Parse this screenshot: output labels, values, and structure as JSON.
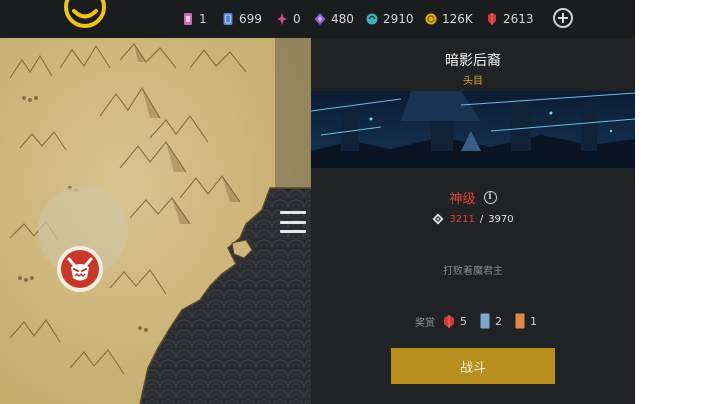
{
  "resources": [
    {
      "icon": "ticket-icon",
      "value": "1",
      "color": "#c86bb8"
    },
    {
      "icon": "card-icon",
      "value": "699",
      "color": "#4f7fd8"
    },
    {
      "icon": "star-gem-icon",
      "value": "0",
      "color": "#d04a8a"
    },
    {
      "icon": "diamond-icon",
      "value": "480",
      "color": "#8a5bd0"
    },
    {
      "icon": "swirl-icon",
      "value": "2910",
      "color": "#3fb0b8"
    },
    {
      "icon": "coin-icon",
      "value": "126K",
      "color": "#e0b020"
    },
    {
      "icon": "ruby-icon",
      "value": "2613",
      "color": "#d43a3a"
    }
  ],
  "boss": {
    "name": "暗影后裔",
    "rank": "头目",
    "difficulty": "神级",
    "power_current": "3211",
    "power_separator": "/",
    "power_required": "3970",
    "objective": "打败着魔君主"
  },
  "rewards": {
    "label": "奖赏",
    "items": [
      {
        "icon": "ruby-icon",
        "count": "5",
        "color": "#d43a3a"
      },
      {
        "icon": "blue-card-icon",
        "count": "2",
        "color": "#7fa6cf"
      },
      {
        "icon": "orange-card-icon",
        "count": "1",
        "color": "#e08a4a"
      }
    ]
  },
  "fight_button": "战斗",
  "colors": {
    "accent_gold": "#b88e1e",
    "difficulty_red": "#e0433a",
    "panel_bg": "#212224"
  }
}
